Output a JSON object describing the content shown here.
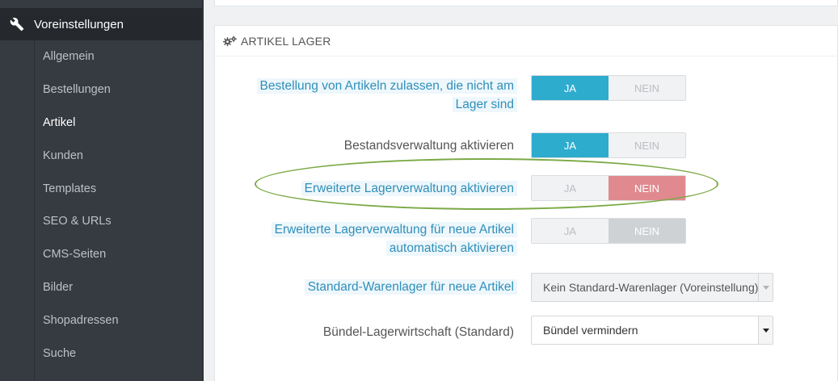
{
  "sidebar": {
    "section_label": "Voreinstellungen",
    "items": [
      {
        "label": "Allgemein",
        "active": false
      },
      {
        "label": "Bestellungen",
        "active": false
      },
      {
        "label": "Artikel",
        "active": true
      },
      {
        "label": "Kunden",
        "active": false
      },
      {
        "label": "Templates",
        "active": false
      },
      {
        "label": "SEO & URLs",
        "active": false
      },
      {
        "label": "CMS-Seiten",
        "active": false
      },
      {
        "label": "Bilder",
        "active": false
      },
      {
        "label": "Shopadressen",
        "active": false
      },
      {
        "label": "Suche",
        "active": false
      }
    ]
  },
  "panel": {
    "title": "Artikel Lager",
    "settings": [
      {
        "label_line1": "Bestellung von Artikeln zulassen, die nicht am",
        "label_line2": "Lager sind",
        "yes": "JA",
        "no": "NEIN",
        "value": "JA"
      },
      {
        "label": "Bestandsverwaltung aktivieren",
        "yes": "JA",
        "no": "NEIN",
        "value": "JA"
      },
      {
        "label": "Erweiterte Lagerverwaltung aktivieren",
        "yes": "JA",
        "no": "NEIN",
        "value": "NEIN"
      },
      {
        "label_line1": "Erweiterte Lagerverwaltung für neue Artikel",
        "label_line2": "automatisch aktivieren",
        "yes": "JA",
        "no": "NEIN",
        "value": "NEIN"
      },
      {
        "label": "Standard-Warenlager für neue Artikel",
        "selected": "Kein Standard-Warenlager (Voreinstellung)"
      },
      {
        "label": "Bündel-Lagerwirtschaft (Standard)",
        "selected": "Bündel vermindern"
      }
    ]
  },
  "colors": {
    "sidebar_bg": "#363a41",
    "sidebar_active_bg": "#25282d",
    "switch_on": "#2eacce",
    "switch_no_red": "#e08a8f",
    "hint_text": "#2f8fba",
    "highlight_ellipse": "#7aa945"
  },
  "icons": {
    "sidebar_section": "wrench-icon",
    "panel_heading": "cogs-icon",
    "select_arrow": "caret-down-icon"
  }
}
